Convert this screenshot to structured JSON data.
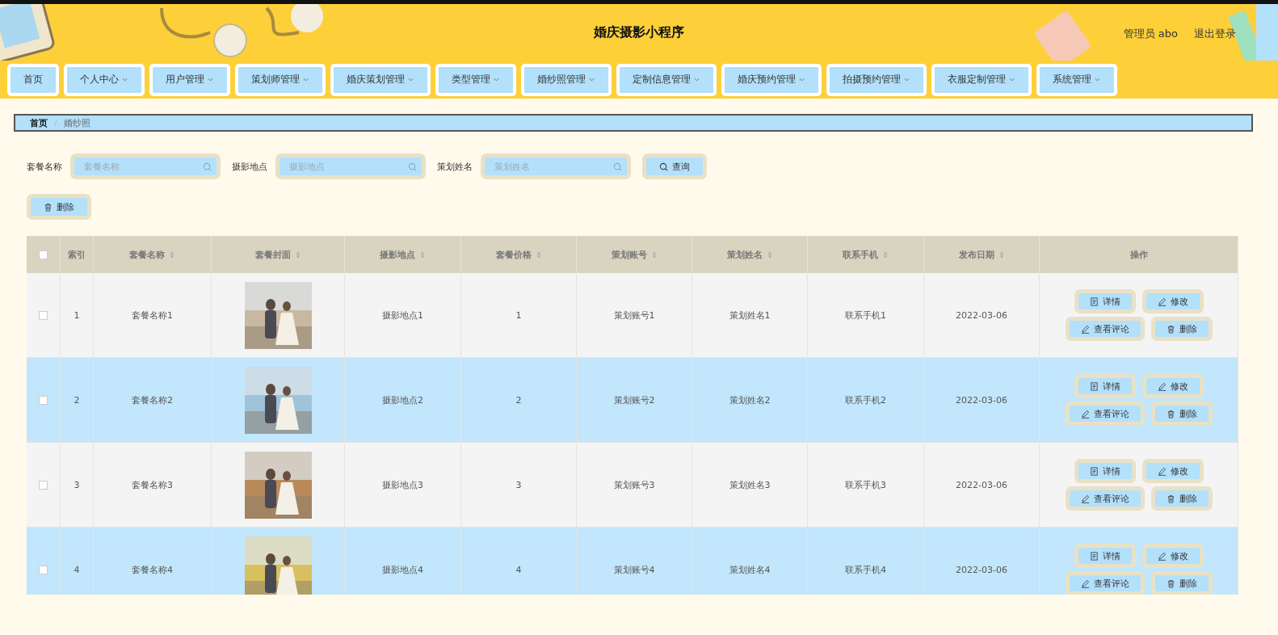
{
  "header": {
    "title": "婚庆摄影小程序",
    "user": "管理员 abo",
    "logout": "退出登录"
  },
  "nav": [
    {
      "label": "首页",
      "dropdown": false
    },
    {
      "label": "个人中心",
      "dropdown": true
    },
    {
      "label": "用户管理",
      "dropdown": true
    },
    {
      "label": "策划师管理",
      "dropdown": true
    },
    {
      "label": "婚庆策划管理",
      "dropdown": true
    },
    {
      "label": "类型管理",
      "dropdown": true
    },
    {
      "label": "婚纱照管理",
      "dropdown": true
    },
    {
      "label": "定制信息管理",
      "dropdown": true
    },
    {
      "label": "婚庆预约管理",
      "dropdown": true
    },
    {
      "label": "拍摄预约管理",
      "dropdown": true
    },
    {
      "label": "衣服定制管理",
      "dropdown": true
    },
    {
      "label": "系统管理",
      "dropdown": true
    }
  ],
  "breadcrumb": {
    "items": [
      "首页",
      "婚纱照"
    ],
    "separator": "/"
  },
  "search": {
    "fields": [
      {
        "label": "套餐名称",
        "placeholder": "套餐名称"
      },
      {
        "label": "摄影地点",
        "placeholder": "摄影地点"
      },
      {
        "label": "策划姓名",
        "placeholder": "策划姓名"
      }
    ],
    "button": "查询"
  },
  "delete_button": "删除",
  "table": {
    "all_checked": false,
    "columns": [
      {
        "label": "索引",
        "sortable": false
      },
      {
        "label": "套餐名称",
        "sortable": true
      },
      {
        "label": "套餐封面",
        "sortable": true
      },
      {
        "label": "摄影地点",
        "sortable": true
      },
      {
        "label": "套餐价格",
        "sortable": true
      },
      {
        "label": "策划账号",
        "sortable": true
      },
      {
        "label": "策划姓名",
        "sortable": true
      },
      {
        "label": "联系手机",
        "sortable": true
      },
      {
        "label": "发布日期",
        "sortable": true
      },
      {
        "label": "操作",
        "sortable": false
      }
    ],
    "rows": [
      {
        "checked": false,
        "index": "1",
        "name": "套餐名称1",
        "location": "摄影地点1",
        "price": "1",
        "account": "策划账号1",
        "planner": "策划姓名1",
        "phone": "联系手机1",
        "date": "2022-03-06",
        "actions": [
          "详情",
          "修改",
          "查看评论",
          "删除"
        ]
      },
      {
        "checked": false,
        "index": "2",
        "name": "套餐名称2",
        "location": "摄影地点2",
        "price": "2",
        "account": "策划账号2",
        "planner": "策划姓名2",
        "phone": "联系手机2",
        "date": "2022-03-06",
        "actions": [
          "详情",
          "修改",
          "查看评论",
          "删除"
        ]
      },
      {
        "checked": false,
        "index": "3",
        "name": "套餐名称3",
        "location": "摄影地点3",
        "price": "3",
        "account": "策划账号3",
        "planner": "策划姓名3",
        "phone": "联系手机3",
        "date": "2022-03-06",
        "actions": [
          "详情",
          "修改",
          "查看评论",
          "删除"
        ]
      },
      {
        "checked": false,
        "index": "4",
        "name": "套餐名称4",
        "location": "摄影地点4",
        "price": "4",
        "account": "策划账号4",
        "planner": "策划姓名4",
        "phone": "联系手机4",
        "date": "2022-03-06",
        "actions": [
          "详情",
          "修改",
          "查看评论",
          "删除"
        ]
      }
    ]
  }
}
